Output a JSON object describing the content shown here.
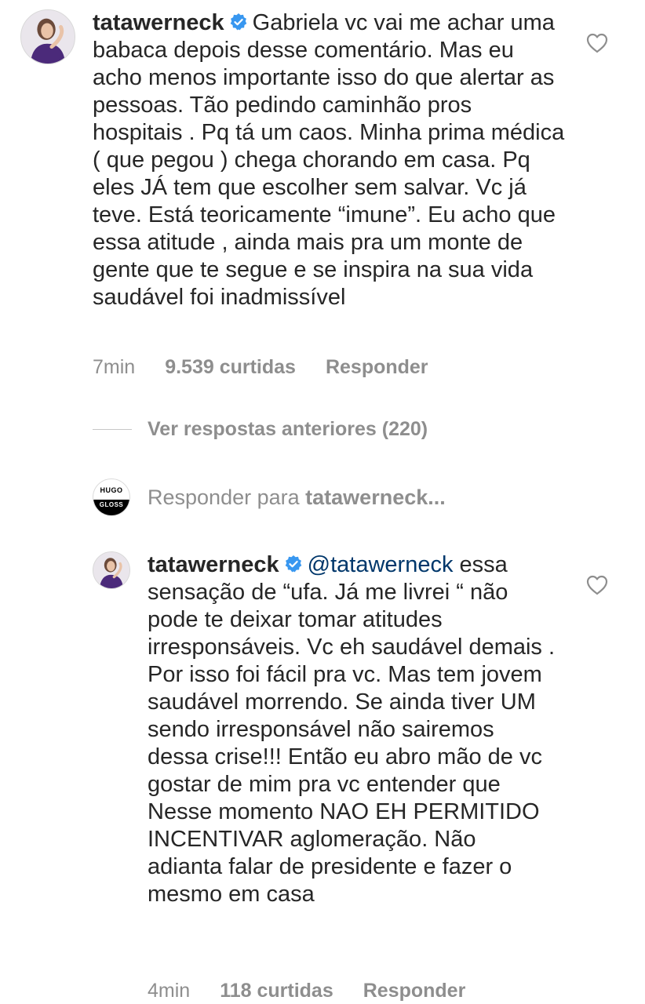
{
  "comments": [
    {
      "username": "tatawerneck",
      "text": "Gabriela vc vai me achar uma babaca depois desse comentário. Mas eu acho menos importante isso do que alertar as pessoas. Tão pedindo caminhão pros hospitais . Pq tá um caos. Minha prima médica ( que pegou ) chega chorando em casa. Pq eles JÁ tem que escolher sem salvar. Vc já teve. Está teoricamente “imune”. Eu acho que essa atitude , ainda mais pra um monte de gente que te segue e se inspira na sua vida saudável foi inadmissível",
      "time": "7min",
      "likes": "9.539 curtidas",
      "reply_label": "Responder"
    },
    {
      "username": "tatawerneck",
      "mention": "@tatawerneck",
      "text": "essa sensação de “ufa. Já me livrei “ não pode te deixar tomar atitudes irresponsáveis. Vc eh saudável demais . Por isso foi fácil pra vc. Mas tem jovem saudável morrendo. Se ainda tiver UM sendo irresponsável não sairemos dessa crise!!! Então eu abro mão de vc gostar de mim pra vc entender que Nesse momento NAO EH PERMITIDO INCENTIVAR aglomeração. Não adianta falar de presidente e fazer o mesmo em casa",
      "time": "4min",
      "likes": "118 curtidas",
      "reply_label": "Responder"
    }
  ],
  "view_replies": "Ver respostas anteriores (220)",
  "reply_bar": {
    "prefix": "Responder para",
    "target": "tatawerneck...",
    "avatar_top": "HUGO",
    "avatar_bottom": "GLOSS"
  },
  "colors": {
    "text": "#262626",
    "muted": "#8e8e8e",
    "verified": "#3897f0",
    "mention": "#00376b"
  },
  "icons": [
    "verified-badge-icon",
    "heart-outline-icon"
  ]
}
